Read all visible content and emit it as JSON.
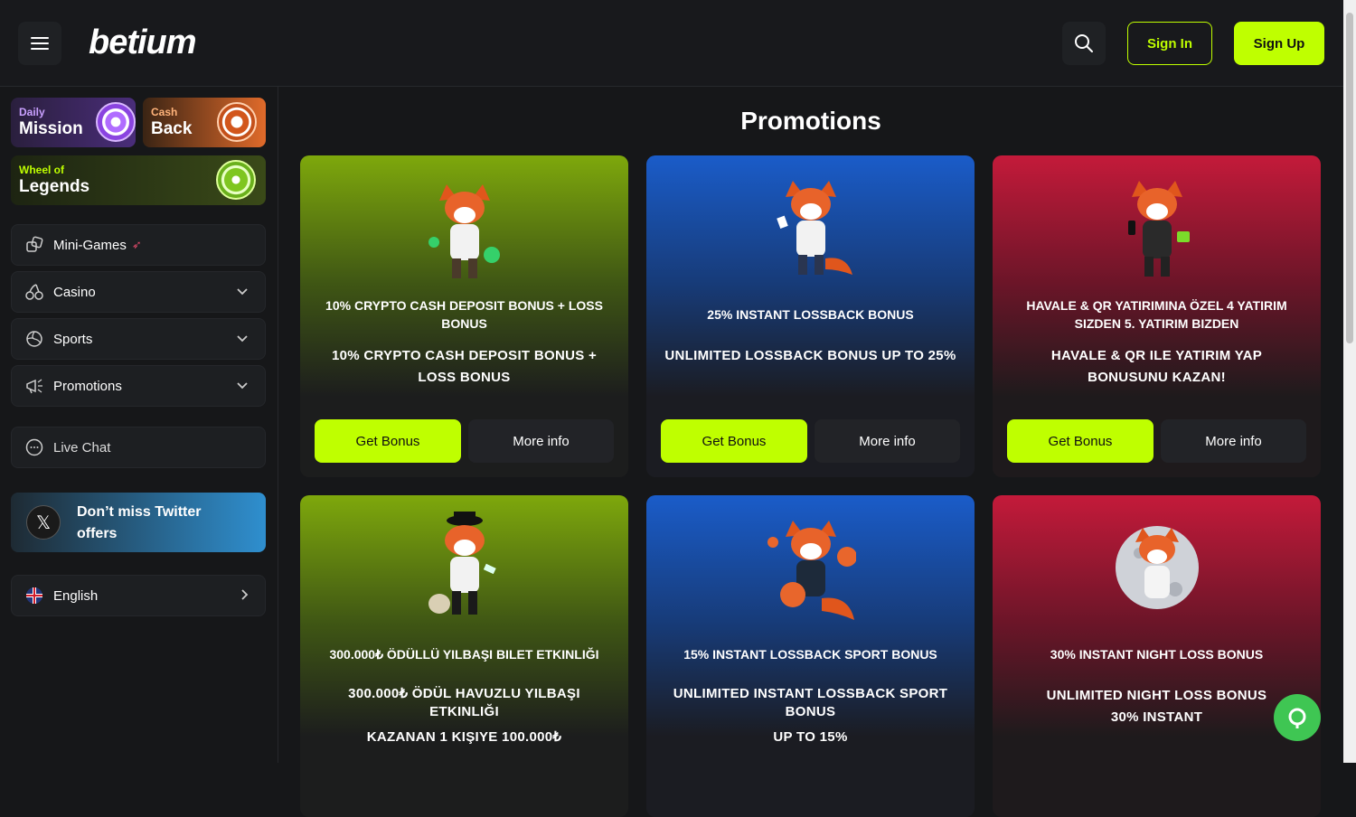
{
  "header": {
    "logo_text": "betium",
    "signin_label": "Sign In",
    "signup_label": "Sign Up"
  },
  "sidebar": {
    "daily_mission": {
      "small": "Daily",
      "big": "Mission"
    },
    "cash_back": {
      "small": "Cash",
      "big": "Back"
    },
    "wheel": {
      "small": "Wheel of",
      "big": "Legends"
    },
    "items": [
      {
        "label": "Mini-Games",
        "icon": "dice-icon"
      },
      {
        "label": "Casino",
        "icon": "cherries-icon"
      },
      {
        "label": "Sports",
        "icon": "volleyball-icon"
      },
      {
        "label": "Promotions",
        "icon": "megaphone-icon"
      }
    ],
    "live_chat": "Live Chat",
    "twitter": "Don’t miss Twitter offers",
    "language": "English"
  },
  "main": {
    "title": "Promotions",
    "cards": [
      {
        "sub": "10% CRYPTO CASH DEPOSIT BONUS + LOSS BONUS",
        "head": "10% CRYPTO CASH DEPOSIT BONUS + LOSS BONUS",
        "get": "Get Bonus",
        "more": "More info",
        "theme": "green"
      },
      {
        "sub": "25% INSTANT LOSSBACK BONUS",
        "head": "UNLIMITED LOSSBACK BONUS UP TO 25%",
        "get": "Get Bonus",
        "more": "More info",
        "theme": "blue"
      },
      {
        "sub": "HAVALE & QR YATIRIMINA ÖZEL 4 YATIRIM SIZDEN 5. YATIRIM BIZDEN",
        "head": "HAVALE & QR ILE YATIRIM YAP BONUSUNU KAZAN!",
        "get": "Get Bonus",
        "more": "More info",
        "theme": "red"
      },
      {
        "sub": "300.000₺ ÖDÜLLÜ YILBAŞI BILET ETKINLIĞI",
        "head": "300.000₺ ÖDÜL HAVUZLU YILBAŞI ETKINLIĞI",
        "head2": "KAZANAN 1 KIŞIYE 100.000₺",
        "theme": "green"
      },
      {
        "sub": "15% INSTANT LOSSBACK SPORT BONUS",
        "head": "UNLIMITED INSTANT LOSSBACK SPORT BONUS",
        "head2": "UP TO 15%",
        "theme": "blue"
      },
      {
        "sub": "30% INSTANT NIGHT LOSS BONUS",
        "head": "UNLIMITED NIGHT LOSS BONUS",
        "head2": "30% INSTANT",
        "theme": "red"
      }
    ]
  },
  "colors": {
    "accent": "#bfff00",
    "chat": "#3fc653"
  }
}
